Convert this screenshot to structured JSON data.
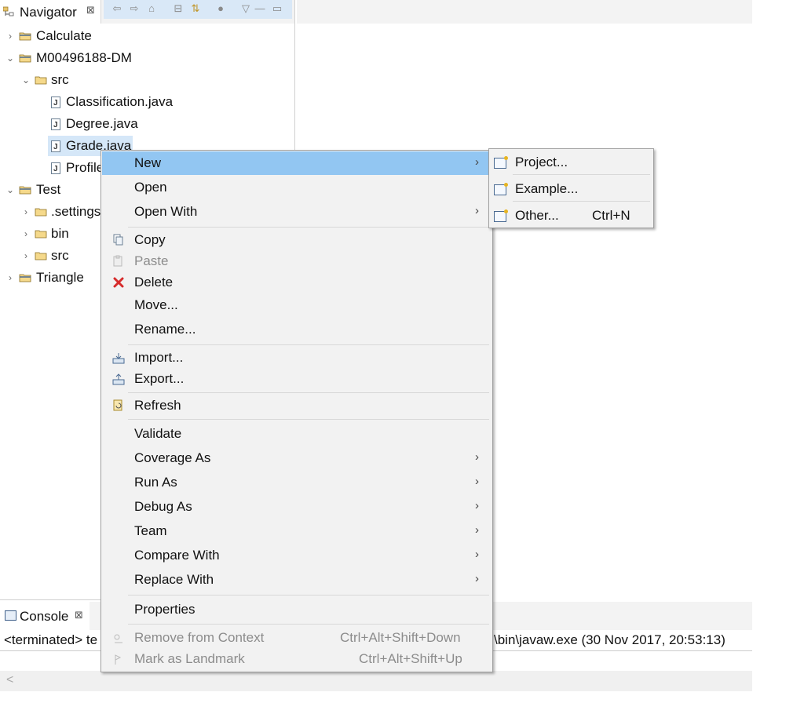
{
  "navigator": {
    "title": "Navigator",
    "close": "⊠",
    "tree": [
      {
        "label": "Calculate",
        "expanded": false
      },
      {
        "label": "M00496188-DM",
        "expanded": true
      },
      {
        "label": "src",
        "expanded": true
      },
      {
        "label": "Classification.java"
      },
      {
        "label": "Degree.java"
      },
      {
        "label": "Grade.java",
        "selected": true
      },
      {
        "label": "Profile"
      },
      {
        "label": "Test",
        "expanded": true
      },
      {
        "label": ".settings",
        "expanded": false
      },
      {
        "label": "bin",
        "expanded": false
      },
      {
        "label": "src",
        "expanded": false
      },
      {
        "label": "Triangle",
        "expanded": false
      }
    ]
  },
  "context_menu": {
    "items": [
      {
        "label": "New",
        "submenu": true,
        "highlighted": true
      },
      {
        "label": "Open"
      },
      {
        "label": "Open With",
        "submenu": true
      },
      {
        "label": "Copy",
        "icon": "copy-icon"
      },
      {
        "label": "Paste",
        "icon": "paste-icon",
        "disabled": true
      },
      {
        "label": "Delete",
        "icon": "delete-icon"
      },
      {
        "label": "Move..."
      },
      {
        "label": "Rename..."
      },
      {
        "label": "Import...",
        "icon": "import-icon"
      },
      {
        "label": "Export...",
        "icon": "export-icon"
      },
      {
        "label": "Refresh",
        "icon": "refresh-icon"
      },
      {
        "label": "Validate"
      },
      {
        "label": "Coverage As",
        "submenu": true
      },
      {
        "label": "Run As",
        "submenu": true
      },
      {
        "label": "Debug As",
        "submenu": true
      },
      {
        "label": "Team",
        "submenu": true
      },
      {
        "label": "Compare With",
        "submenu": true
      },
      {
        "label": "Replace With",
        "submenu": true
      },
      {
        "label": "Properties"
      },
      {
        "label": "Remove from Context",
        "shortcut": "Ctrl+Alt+Shift+Down",
        "disabled": true,
        "icon": "remove-context-icon"
      },
      {
        "label": "Mark as Landmark",
        "shortcut": "Ctrl+Alt+Shift+Up",
        "disabled": true,
        "icon": "landmark-icon"
      }
    ]
  },
  "submenu_new": {
    "items": [
      {
        "label": "Project..."
      },
      {
        "label": "Example..."
      },
      {
        "label": "Other...",
        "shortcut": "Ctrl+N"
      }
    ]
  },
  "console": {
    "title": "Console",
    "close": "⊠",
    "line_left": "<terminated> te",
    "line_right": "\\bin\\javaw.exe (30 Nov 2017, 20:53:13)"
  },
  "arrows": {
    "submenu": "›",
    "expand": "›",
    "collapse": "⌄",
    "scroll_left": "<"
  }
}
